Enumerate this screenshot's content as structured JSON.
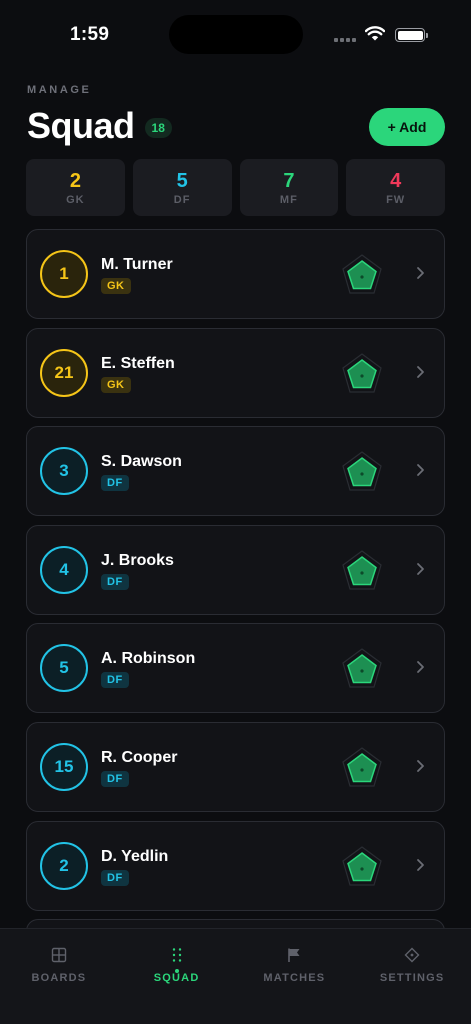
{
  "status": {
    "time": "1:59"
  },
  "header": {
    "eyebrow": "MANAGE",
    "title": "Squad",
    "count": "18",
    "add_label": "+ Add"
  },
  "colors": {
    "accent": "#2bd67b",
    "gk": "#f5c518",
    "df": "#22c3e6",
    "mf": "#2bd67b",
    "fw": "#f0395a"
  },
  "stats": [
    {
      "value": "2",
      "label": "GK",
      "color": "#f5c518"
    },
    {
      "value": "5",
      "label": "DF",
      "color": "#22c3e6"
    },
    {
      "value": "7",
      "label": "MF",
      "color": "#2bd67b"
    },
    {
      "value": "4",
      "label": "FW",
      "color": "#f0395a"
    }
  ],
  "players": [
    {
      "number": "1",
      "name": "M. Turner",
      "position": "GK"
    },
    {
      "number": "21",
      "name": "E. Steffen",
      "position": "GK"
    },
    {
      "number": "3",
      "name": "S. Dawson",
      "position": "DF"
    },
    {
      "number": "4",
      "name": "J. Brooks",
      "position": "DF"
    },
    {
      "number": "5",
      "name": "A. Robinson",
      "position": "DF"
    },
    {
      "number": "15",
      "name": "R. Cooper",
      "position": "DF"
    },
    {
      "number": "2",
      "name": "D. Yedlin",
      "position": "DF"
    }
  ],
  "tabs": [
    {
      "label": "BOARDS",
      "icon": "grid-icon",
      "active": false
    },
    {
      "label": "SQUAD",
      "icon": "dots-grid-icon",
      "active": true
    },
    {
      "label": "MATCHES",
      "icon": "flag-icon",
      "active": false
    },
    {
      "label": "SETTINGS",
      "icon": "diamond-icon",
      "active": false
    }
  ]
}
